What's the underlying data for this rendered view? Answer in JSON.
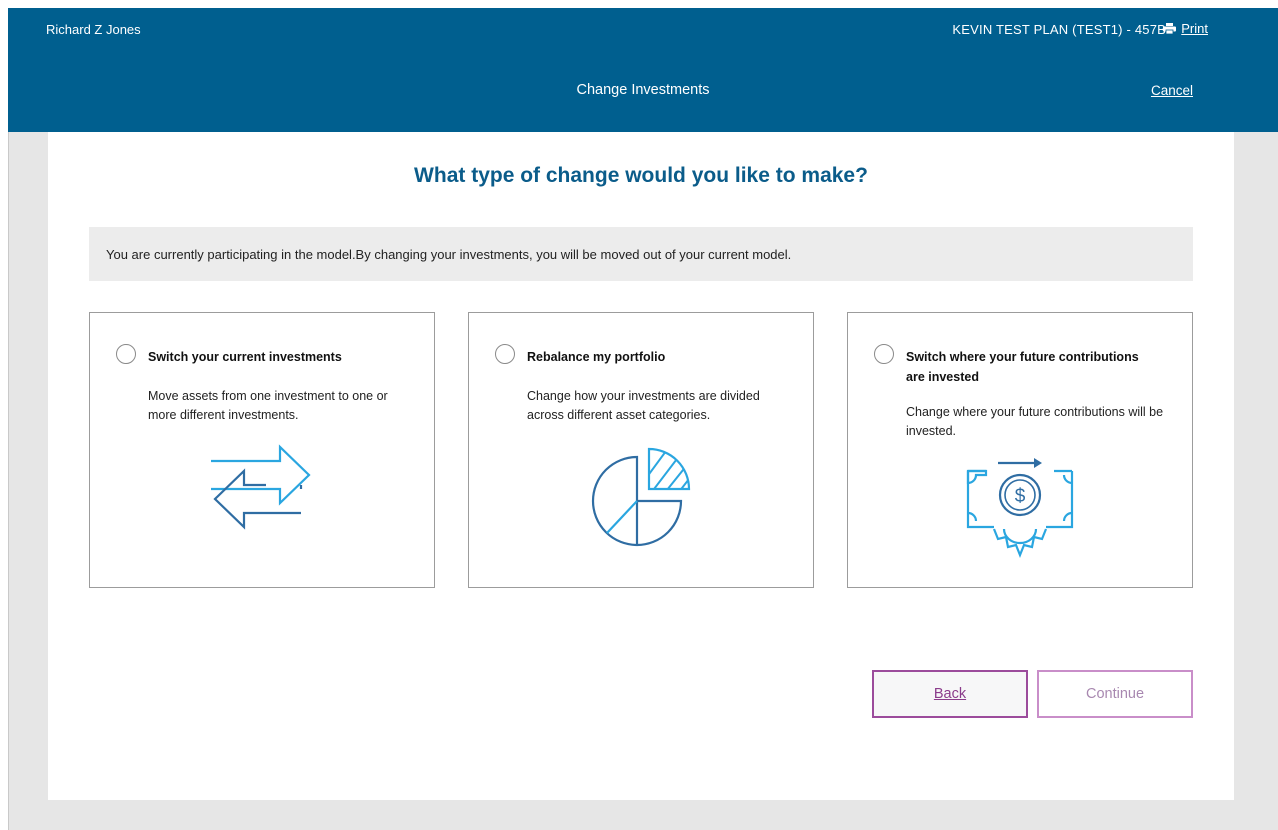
{
  "header": {
    "user_name": "Richard Z Jones",
    "plan_name": "KEVIN TEST PLAN (TEST1) - 457B",
    "print_label": "Print",
    "page_title": "Change Investments",
    "cancel_label": "Cancel"
  },
  "main": {
    "question": "What type of change would you like to make?",
    "notice": "You are currently participating in the model.By changing your investments, you will be moved out of your current model.",
    "options": [
      {
        "title": "Switch your current investments",
        "description": "Move assets from one investment to one or more different investments.",
        "icon": "swap-arrows-icon",
        "selected": false
      },
      {
        "title": "Rebalance my portfolio",
        "description": "Change how your investments are divided across different asset categories.",
        "icon": "pie-chart-icon",
        "selected": false
      },
      {
        "title": "Switch where your future contributions are invested",
        "description": "Change where your future contributions will be invested.",
        "icon": "money-gear-icon",
        "selected": false
      }
    ]
  },
  "actions": {
    "back_label": "Back",
    "continue_label": "Continue",
    "continue_enabled": false
  },
  "colors": {
    "header_bg": "#005f8f",
    "heading_text": "#0b5c8a",
    "button_border": "#9c4c9c",
    "icon_dark": "#2f6da3",
    "icon_light": "#2aa6e0"
  }
}
